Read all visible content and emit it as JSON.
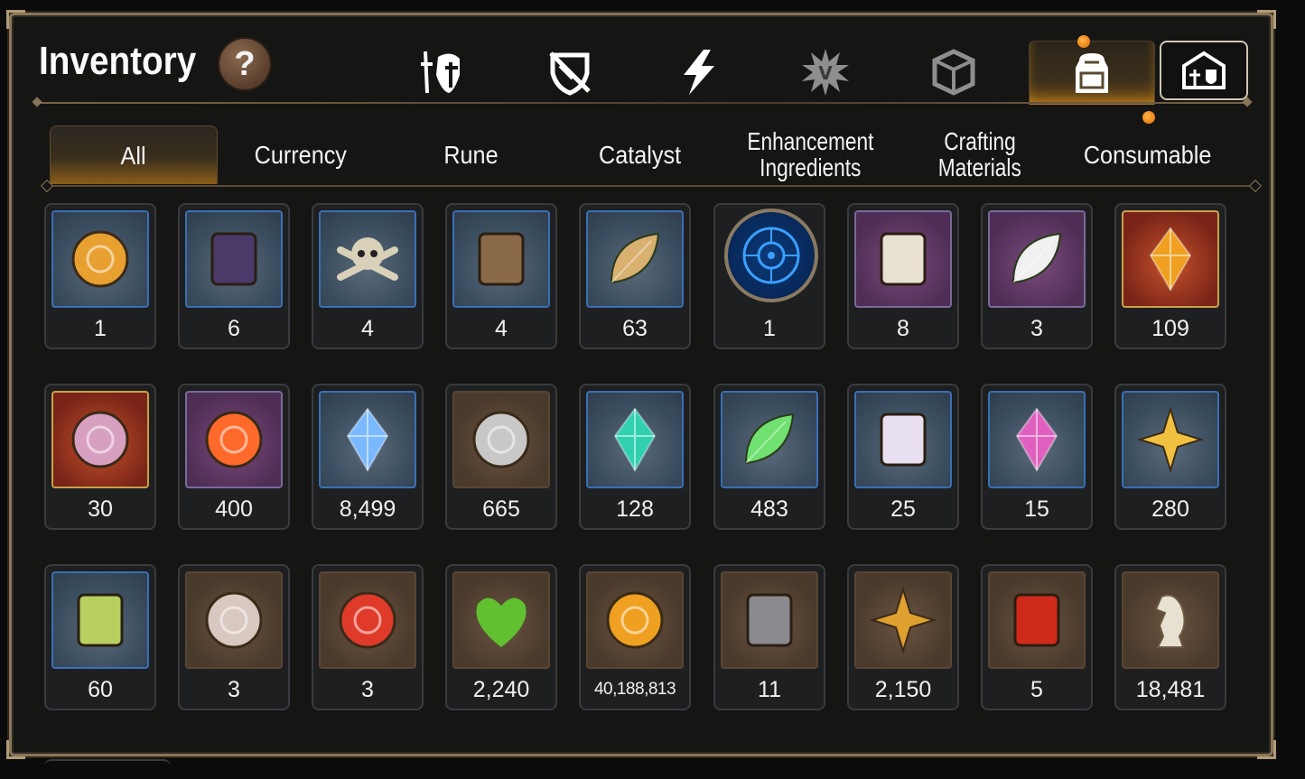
{
  "header": {
    "title": "Inventory",
    "help_label": "?"
  },
  "category_tabs": [
    {
      "name": "equipment-tab",
      "icon": "knight-helmet-icon",
      "active": false
    },
    {
      "name": "shield-tab",
      "icon": "crossed-shield-icon",
      "active": false
    },
    {
      "name": "skill-tab",
      "icon": "lightning-bolt-icon",
      "active": false
    },
    {
      "name": "burst-tab",
      "icon": "spiked-burst-icon",
      "active": false
    },
    {
      "name": "cube-tab",
      "icon": "cube-icon",
      "active": false
    },
    {
      "name": "bag-tab",
      "icon": "backpack-icon",
      "active": true
    },
    {
      "name": "guild-tab",
      "icon": "guild-castle-icon",
      "active": false
    }
  ],
  "sub_tabs": [
    "All",
    "Currency",
    "Rune",
    "Catalyst",
    "Enhancement Ingredients",
    "Crafting Materials",
    "Consumable"
  ],
  "sub_tab_lines": {
    "enhancement": [
      "Enhancement",
      "Ingredients"
    ],
    "crafting": [
      "Crafting",
      "Materials"
    ]
  },
  "items": [
    {
      "icon": "gold-sun-medallion-icon",
      "count": "1"
    },
    {
      "icon": "dark-scale-plates-icon",
      "count": "6"
    },
    {
      "icon": "skull-crossbones-icon",
      "count": "4"
    },
    {
      "icon": "leather-pouch-icon",
      "count": "4"
    },
    {
      "icon": "feather-berry-icon",
      "count": "63"
    },
    {
      "icon": "blue-portal-rune-icon",
      "count": "1"
    },
    {
      "icon": "pet-food-bag-icon",
      "count": "8"
    },
    {
      "icon": "feather-wand-icon",
      "count": "3"
    },
    {
      "icon": "amber-crystal-icon",
      "count": "109"
    },
    {
      "icon": "pink-ring-necklace-icon",
      "count": "30"
    },
    {
      "icon": "orange-flower-ring-icon",
      "count": "400"
    },
    {
      "icon": "blue-crystal-icon",
      "count": "8,499"
    },
    {
      "icon": "silver-coin-icon",
      "count": "665"
    },
    {
      "icon": "teal-crystal-icon",
      "count": "128"
    },
    {
      "icon": "green-leaf-icon",
      "count": "483"
    },
    {
      "icon": "paw-certificate-icon",
      "count": "25"
    },
    {
      "icon": "pink-crystal-pile-icon",
      "count": "15"
    },
    {
      "icon": "star-pendant-icon",
      "count": "280"
    },
    {
      "icon": "costume-card-icon",
      "count": "60"
    },
    {
      "icon": "armor-orb-icon",
      "count": "3"
    },
    {
      "icon": "red-seal-badge-icon",
      "count": "3"
    },
    {
      "icon": "green-heart-icon",
      "count": "2,240"
    },
    {
      "icon": "gold-sun-coin-icon",
      "count": "40,188,813"
    },
    {
      "icon": "compass-stone-icon",
      "count": "11"
    },
    {
      "icon": "fist-emblem-icon",
      "count": "2,150"
    },
    {
      "icon": "red-banner-icon",
      "count": "5"
    },
    {
      "icon": "knight-chess-piece-icon",
      "count": "18,481"
    }
  ],
  "colors": {
    "accent_gold": "#d08a1a",
    "frame_border": "#8a7558",
    "notification_dot": "#f08a1a"
  }
}
